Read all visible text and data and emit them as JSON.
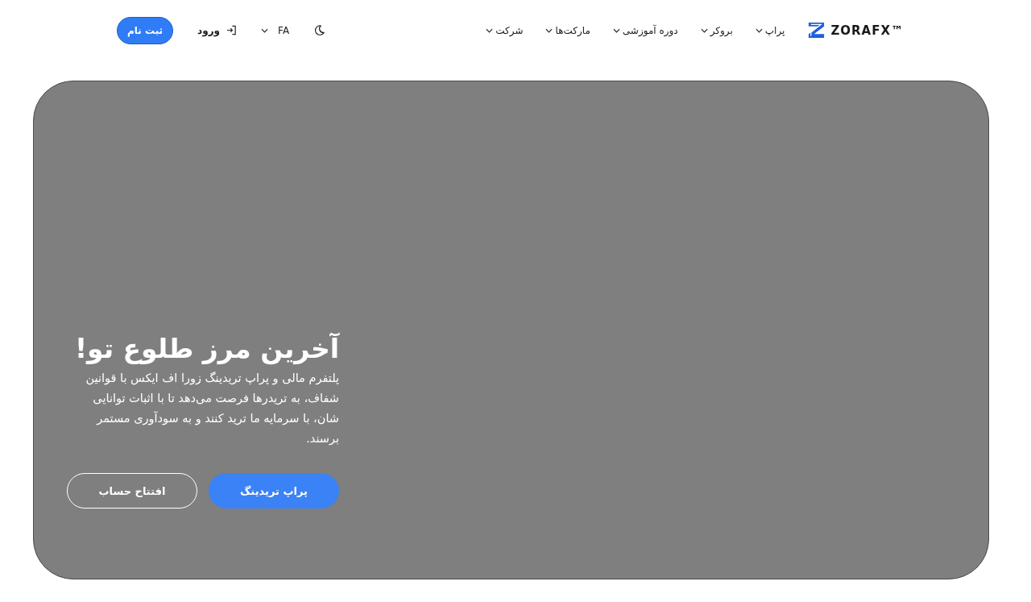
{
  "header": {
    "brand": "ZORAFX™",
    "nav": [
      {
        "label": "پراپ"
      },
      {
        "label": "بروکر"
      },
      {
        "label": "دوره آموزشی"
      },
      {
        "label": "مارکت‌ها"
      },
      {
        "label": "شرکت"
      }
    ],
    "language": "FA",
    "login": "ورود",
    "register": "ثبت نام"
  },
  "hero": {
    "title": "آخرین مرز طلوع تو!",
    "description": "پلتفرم مالی و پراپ تریدینگ زورا اف ایکس با قوانین شفاف، به تریدرها فرصت می‌دهد تا با اثبات توانایی شان، با سرمایه ما ترید کنند و به سودآوری مستمر برسند.",
    "buttons": [
      {
        "label": "پراپ تریدینگ",
        "kind": "primary"
      },
      {
        "label": "افتتاح حساب",
        "kind": "outline"
      }
    ]
  }
}
